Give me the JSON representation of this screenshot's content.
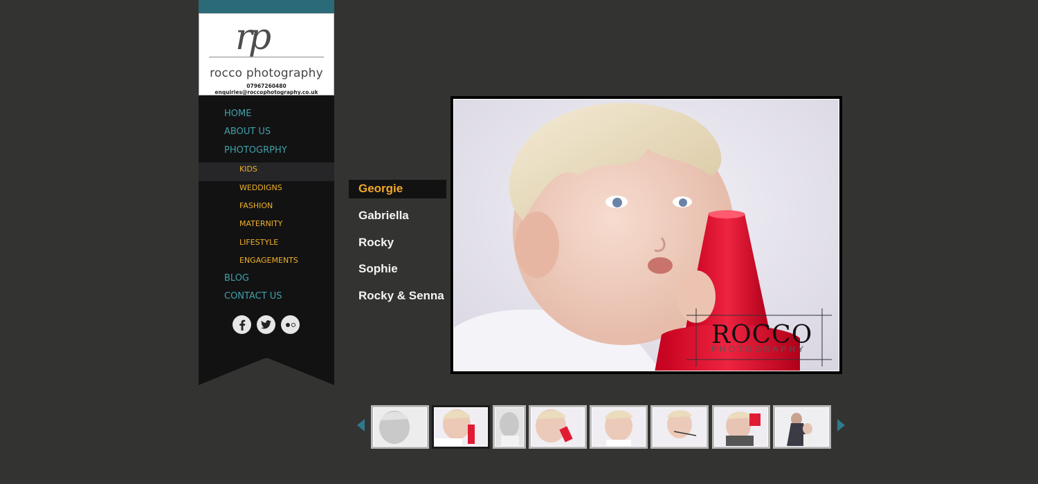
{
  "logo": {
    "monogram": "rp",
    "name": "rocco photography",
    "contact": "07967260480 enquiries@roccophotography.co.uk"
  },
  "nav": {
    "items": [
      {
        "label": "HOME"
      },
      {
        "label": "ABOUT US"
      },
      {
        "label": "PHOTOGRPHY"
      }
    ],
    "subitems": [
      {
        "label": "KIDS",
        "active": true
      },
      {
        "label": "WEDDIGNS"
      },
      {
        "label": "FASHION"
      },
      {
        "label": "MATERNITY"
      },
      {
        "label": "LIFESTYLE"
      },
      {
        "label": "ENGAGEMENTS"
      }
    ],
    "bottom_items": [
      {
        "label": "BLOG"
      },
      {
        "label": "CONTACT US"
      }
    ],
    "social": [
      "facebook-icon",
      "twitter-icon",
      "flickr-icon"
    ]
  },
  "galleries": [
    {
      "label": "Georgie",
      "active": true
    },
    {
      "label": "Gabriella"
    },
    {
      "label": "Rocky"
    },
    {
      "label": "Sophie"
    },
    {
      "label": "Rocky & Senna"
    }
  ],
  "photo": {
    "watermark_main": "ROCCO",
    "watermark_sub": "PHOTOGRAPHY"
  },
  "thumbnails": {
    "count": 8,
    "selected_index": 1
  },
  "colors": {
    "accent_teal": "#3fa1a8",
    "accent_orange": "#f0b22b",
    "background": "#333331",
    "sidebar": "#131213"
  }
}
